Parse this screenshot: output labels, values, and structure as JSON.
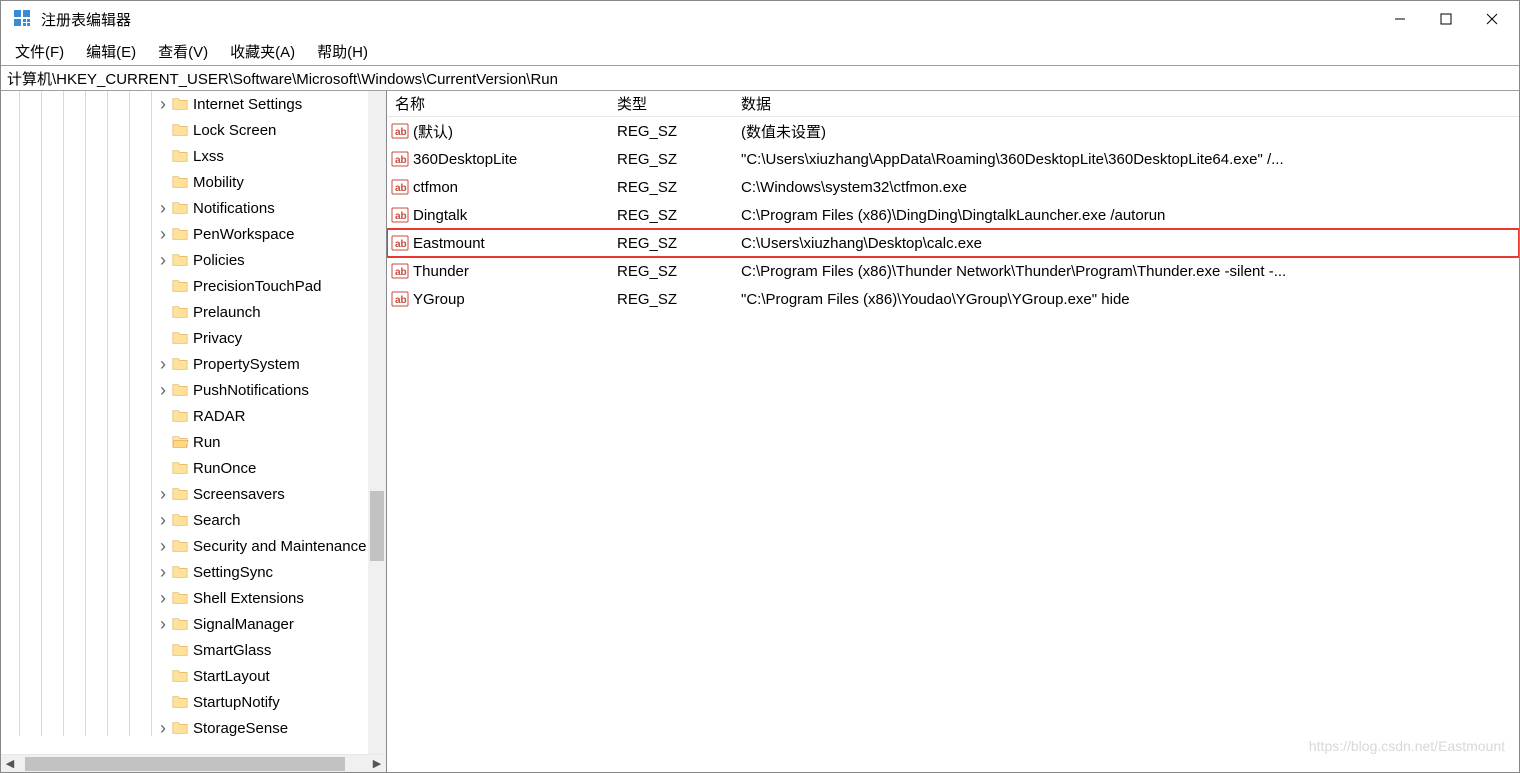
{
  "window": {
    "title": "注册表编辑器"
  },
  "menubar": {
    "file": "文件(F)",
    "edit": "编辑(E)",
    "view": "查看(V)",
    "fav": "收藏夹(A)",
    "help": "帮助(H)"
  },
  "address": "计算机\\HKEY_CURRENT_USER\\Software\\Microsoft\\Windows\\CurrentVersion\\Run",
  "tree_items": [
    {
      "label": "Internet Settings",
      "exp": ">"
    },
    {
      "label": "Lock Screen",
      "exp": ""
    },
    {
      "label": "Lxss",
      "exp": ""
    },
    {
      "label": "Mobility",
      "exp": ""
    },
    {
      "label": "Notifications",
      "exp": ">"
    },
    {
      "label": "PenWorkspace",
      "exp": ">"
    },
    {
      "label": "Policies",
      "exp": ">"
    },
    {
      "label": "PrecisionTouchPad",
      "exp": ""
    },
    {
      "label": "Prelaunch",
      "exp": ""
    },
    {
      "label": "Privacy",
      "exp": ""
    },
    {
      "label": "PropertySystem",
      "exp": ">"
    },
    {
      "label": "PushNotifications",
      "exp": ">"
    },
    {
      "label": "RADAR",
      "exp": ""
    },
    {
      "label": "Run",
      "exp": "",
      "selected": true
    },
    {
      "label": "RunOnce",
      "exp": ""
    },
    {
      "label": "Screensavers",
      "exp": ">"
    },
    {
      "label": "Search",
      "exp": ">"
    },
    {
      "label": "Security and Maintenance",
      "exp": ">"
    },
    {
      "label": "SettingSync",
      "exp": ">"
    },
    {
      "label": "Shell Extensions",
      "exp": ">"
    },
    {
      "label": "SignalManager",
      "exp": ">"
    },
    {
      "label": "SmartGlass",
      "exp": ""
    },
    {
      "label": "StartLayout",
      "exp": ""
    },
    {
      "label": "StartupNotify",
      "exp": ""
    },
    {
      "label": "StorageSense",
      "exp": ">"
    }
  ],
  "list": {
    "headers": {
      "name": "名称",
      "type": "类型",
      "data": "数据"
    },
    "rows": [
      {
        "name": "(默认)",
        "type": "REG_SZ",
        "data": "(数值未设置)",
        "hl": false
      },
      {
        "name": "360DesktopLite",
        "type": "REG_SZ",
        "data": "\"C:\\Users\\xiuzhang\\AppData\\Roaming\\360DesktopLite\\360DesktopLite64.exe\" /...",
        "hl": false
      },
      {
        "name": "ctfmon",
        "type": "REG_SZ",
        "data": "C:\\Windows\\system32\\ctfmon.exe",
        "hl": false
      },
      {
        "name": "Dingtalk",
        "type": "REG_SZ",
        "data": "C:\\Program Files (x86)\\DingDing\\DingtalkLauncher.exe /autorun",
        "hl": false
      },
      {
        "name": "Eastmount",
        "type": "REG_SZ",
        "data": "C:\\Users\\xiuzhang\\Desktop\\calc.exe",
        "hl": true
      },
      {
        "name": "Thunder",
        "type": "REG_SZ",
        "data": "C:\\Program Files (x86)\\Thunder Network\\Thunder\\Program\\Thunder.exe -silent -...",
        "hl": false
      },
      {
        "name": "YGroup",
        "type": "REG_SZ",
        "data": "\"C:\\Program Files (x86)\\Youdao\\YGroup\\YGroup.exe\" hide",
        "hl": false
      }
    ]
  },
  "watermark": "https://blog.csdn.net/Eastmount"
}
